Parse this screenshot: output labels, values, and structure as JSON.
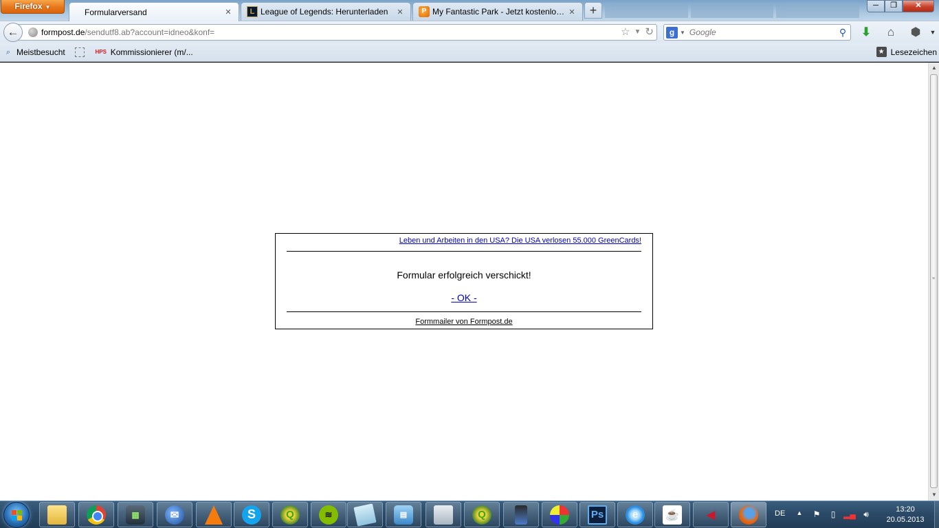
{
  "browser": {
    "menu_label": "Firefox",
    "tabs": [
      {
        "title": "Formularversand",
        "active": true
      },
      {
        "title": "League of Legends: Herunterladen",
        "active": false
      },
      {
        "title": "My Fantastic Park - Jetzt kostenlos spi...",
        "active": false
      }
    ],
    "new_tab_label": "+",
    "url": {
      "domain": "formpost.de",
      "path": "/sendutf8.ab?account=idneo&konf="
    },
    "search": {
      "engine": "Google",
      "placeholder": "Google"
    },
    "bookmarks": [
      {
        "label": "Meistbesucht",
        "icon": "most-visited-icon"
      },
      {
        "label": "",
        "icon": "empty-bookmark-icon"
      },
      {
        "label": "Kommissionierer (m/...",
        "icon": "hps-icon",
        "icon_text": "HPS"
      }
    ],
    "bookmarks_menu_label": "Lesezeichen"
  },
  "page": {
    "ad_link": "Leben und Arbeiten in den USA? Die USA verlosen 55.000 GreenCards!",
    "message": "Formular erfolgreich verschickt!",
    "ok_link": "- OK -",
    "footer_link": "Formmailer von Formpost.de"
  },
  "taskbar": {
    "apps": [
      "explorer",
      "chrome",
      "monitor",
      "thunderbird",
      "vlc",
      "skype",
      "qgis",
      "spotify",
      "notes",
      "control-panel",
      "calculator",
      "qgis",
      "phone",
      "paint",
      "photoshop",
      "internet-explorer",
      "java",
      "red-app",
      "firefox"
    ],
    "ps_label": "Ps",
    "language": "DE",
    "time": "13:20",
    "date": "20.05.2013"
  },
  "colors": {
    "link": "#0000cc",
    "firefox_button": "#e8761c",
    "taskbar": "#2b4a68"
  }
}
